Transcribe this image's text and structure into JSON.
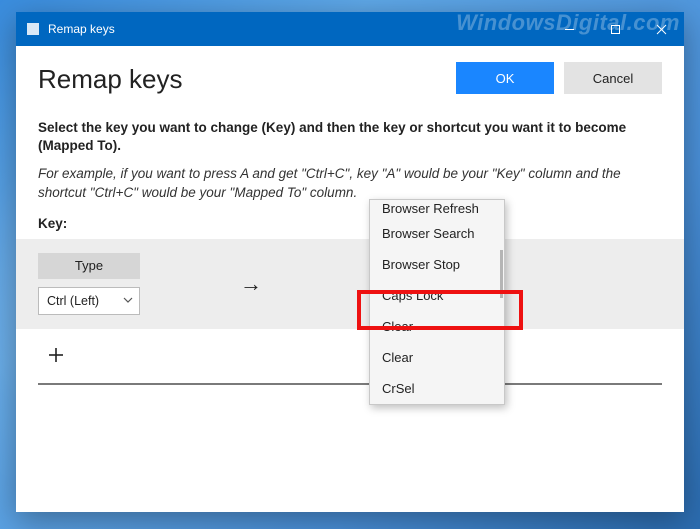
{
  "watermark": "WindowsDigital.com",
  "titlebar": {
    "title": "Remap keys"
  },
  "header": {
    "title": "Remap keys"
  },
  "buttons": {
    "ok": "OK",
    "cancel": "Cancel"
  },
  "instruction": "Select the key you want to change (Key) and then the key or shortcut you want it to become (Mapped To).",
  "example": "For example, if you want to press A and get \"Ctrl+C\", key \"A\" would be your \"Key\" column and the shortcut \"Ctrl+C\" would be your \"Mapped To\" column.",
  "remap": {
    "key_label": "Key:",
    "type_label": "Type",
    "selected_key": "Ctrl (Left)",
    "arrow": "→"
  },
  "add_button_label": "+",
  "dropdown": {
    "items": [
      "Browser Refresh",
      "Browser Search",
      "Browser Stop",
      "Caps Lock",
      "Clear",
      "Clear",
      "CrSel"
    ]
  }
}
